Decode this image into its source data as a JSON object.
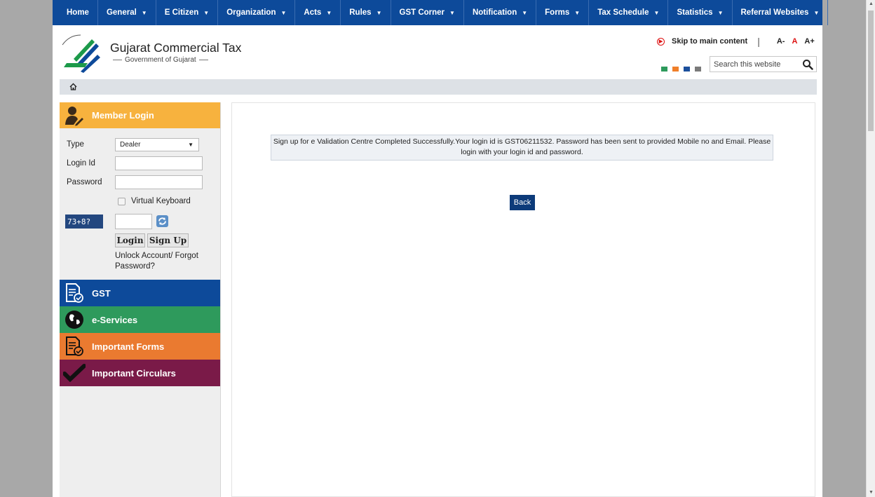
{
  "nav": {
    "items": [
      {
        "label": "Home",
        "has_caret": false
      },
      {
        "label": "General",
        "has_caret": true
      },
      {
        "label": "E Citizen",
        "has_caret": true
      },
      {
        "label": "Organization",
        "has_caret": true
      },
      {
        "label": "Acts",
        "has_caret": true
      },
      {
        "label": "Rules",
        "has_caret": true
      },
      {
        "label": "GST Corner",
        "has_caret": true
      },
      {
        "label": "Notification",
        "has_caret": true
      },
      {
        "label": "Forms",
        "has_caret": true
      },
      {
        "label": "Tax Schedule",
        "has_caret": true
      },
      {
        "label": "Statistics",
        "has_caret": true
      },
      {
        "label": "Referral Websites",
        "has_caret": true
      }
    ]
  },
  "header": {
    "title": "Gujarat Commercial Tax",
    "subtitle": "Government of Gujarat",
    "skip_link": "Skip to main content",
    "font_small": "A-",
    "font_normal": "A",
    "font_large": "A+",
    "search_placeholder": "Search this website",
    "theme_colors": [
      "#2e9a5c",
      "#f07f2a",
      "#1b4f9c",
      "#7a7a7a"
    ]
  },
  "login": {
    "title": "Member Login",
    "type_label": "Type",
    "type_value": "Dealer",
    "login_id_label": "Login Id",
    "password_label": "Password",
    "virtual_keyboard_label": "Virtual Keyboard",
    "captcha": "73+8?",
    "login_button": "Login",
    "signup_button": "Sign Up",
    "unlock_link": "Unlock Account/ Forgot Password?"
  },
  "menu": [
    {
      "label": "GST",
      "color": "#0d4a9a",
      "icon": "document-check-icon"
    },
    {
      "label": "e-Services",
      "color": "#2e9a5c",
      "icon": "globe-icon"
    },
    {
      "label": "Important Forms",
      "color": "#ea7a30",
      "icon": "form-check-icon"
    },
    {
      "label": "Important Circulars",
      "color": "#7a1a48",
      "icon": "checkmark-icon"
    }
  ],
  "content": {
    "message": "Sign up for e Validation Centre Completed Successfully.Your login id is GST06211532. Password has been sent to provided Mobile no and Email. Please login with your login id and password.",
    "back_button": "Back"
  }
}
